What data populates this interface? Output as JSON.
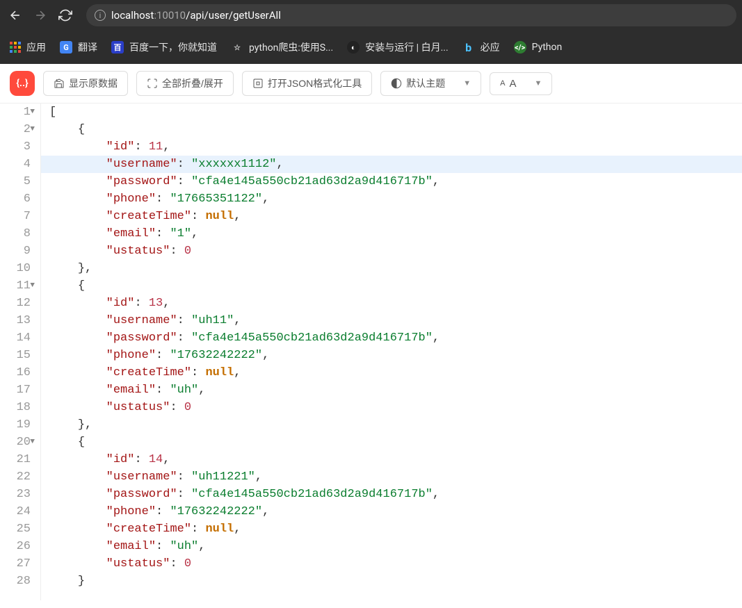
{
  "nav": {
    "url_host": "localhost",
    "url_port": ":10010",
    "url_path": "/api/user/getUserAll"
  },
  "bookmarks": [
    {
      "label": "应用",
      "icon": "apps"
    },
    {
      "label": "翻译",
      "icon": "translate",
      "color": "#4285f4"
    },
    {
      "label": "百度一下，你就知道",
      "icon": "baidu",
      "color": "#2a3ec8"
    },
    {
      "label": "python爬虫:使用S...",
      "icon": "star",
      "color": "transparent"
    },
    {
      "label": "安装与运行 | 白月...",
      "icon": "moon",
      "color": "#333"
    },
    {
      "label": "必应",
      "icon": "bing",
      "color": "transparent"
    },
    {
      "label": "Python",
      "icon": "py",
      "color": "#2e7d32"
    }
  ],
  "toolbar": {
    "show_raw": "显示原数据",
    "collapse_expand": "全部折叠/展开",
    "open_formatter": "打开JSON格式化工具",
    "theme": "默认主题",
    "font_size": "A"
  },
  "json": {
    "lines": [
      {
        "num": 1,
        "fold": true,
        "indent": 0,
        "tokens": [
          {
            "t": "p",
            "v": "["
          }
        ]
      },
      {
        "num": 2,
        "fold": true,
        "indent": 1,
        "tokens": [
          {
            "t": "p",
            "v": "{"
          }
        ]
      },
      {
        "num": 3,
        "indent": 2,
        "tokens": [
          {
            "t": "k",
            "v": "\"id\""
          },
          {
            "t": "p",
            "v": ": "
          },
          {
            "t": "n",
            "v": "11"
          },
          {
            "t": "p",
            "v": ","
          }
        ]
      },
      {
        "num": 4,
        "indent": 2,
        "hl": true,
        "tokens": [
          {
            "t": "k",
            "v": "\"username\""
          },
          {
            "t": "p",
            "v": ": "
          },
          {
            "t": "s",
            "v": "\"xxxxxx1112\""
          },
          {
            "t": "p",
            "v": ","
          }
        ]
      },
      {
        "num": 5,
        "indent": 2,
        "tokens": [
          {
            "t": "k",
            "v": "\"password\""
          },
          {
            "t": "p",
            "v": ": "
          },
          {
            "t": "s",
            "v": "\"cfa4e145a550cb21ad63d2a9d416717b\""
          },
          {
            "t": "p",
            "v": ","
          }
        ]
      },
      {
        "num": 6,
        "indent": 2,
        "tokens": [
          {
            "t": "k",
            "v": "\"phone\""
          },
          {
            "t": "p",
            "v": ": "
          },
          {
            "t": "s",
            "v": "\"17665351122\""
          },
          {
            "t": "p",
            "v": ","
          }
        ]
      },
      {
        "num": 7,
        "indent": 2,
        "tokens": [
          {
            "t": "k",
            "v": "\"createTime\""
          },
          {
            "t": "p",
            "v": ": "
          },
          {
            "t": "nl",
            "v": "null"
          },
          {
            "t": "p",
            "v": ","
          }
        ]
      },
      {
        "num": 8,
        "indent": 2,
        "tokens": [
          {
            "t": "k",
            "v": "\"email\""
          },
          {
            "t": "p",
            "v": ": "
          },
          {
            "t": "s",
            "v": "\"1\""
          },
          {
            "t": "p",
            "v": ","
          }
        ]
      },
      {
        "num": 9,
        "indent": 2,
        "tokens": [
          {
            "t": "k",
            "v": "\"ustatus\""
          },
          {
            "t": "p",
            "v": ": "
          },
          {
            "t": "n",
            "v": "0"
          }
        ]
      },
      {
        "num": 10,
        "indent": 1,
        "tokens": [
          {
            "t": "p",
            "v": "},"
          }
        ]
      },
      {
        "num": 11,
        "fold": true,
        "indent": 1,
        "tokens": [
          {
            "t": "p",
            "v": "{"
          }
        ]
      },
      {
        "num": 12,
        "indent": 2,
        "tokens": [
          {
            "t": "k",
            "v": "\"id\""
          },
          {
            "t": "p",
            "v": ": "
          },
          {
            "t": "n",
            "v": "13"
          },
          {
            "t": "p",
            "v": ","
          }
        ]
      },
      {
        "num": 13,
        "indent": 2,
        "tokens": [
          {
            "t": "k",
            "v": "\"username\""
          },
          {
            "t": "p",
            "v": ": "
          },
          {
            "t": "s",
            "v": "\"uh11\""
          },
          {
            "t": "p",
            "v": ","
          }
        ]
      },
      {
        "num": 14,
        "indent": 2,
        "tokens": [
          {
            "t": "k",
            "v": "\"password\""
          },
          {
            "t": "p",
            "v": ": "
          },
          {
            "t": "s",
            "v": "\"cfa4e145a550cb21ad63d2a9d416717b\""
          },
          {
            "t": "p",
            "v": ","
          }
        ]
      },
      {
        "num": 15,
        "indent": 2,
        "tokens": [
          {
            "t": "k",
            "v": "\"phone\""
          },
          {
            "t": "p",
            "v": ": "
          },
          {
            "t": "s",
            "v": "\"17632242222\""
          },
          {
            "t": "p",
            "v": ","
          }
        ]
      },
      {
        "num": 16,
        "indent": 2,
        "tokens": [
          {
            "t": "k",
            "v": "\"createTime\""
          },
          {
            "t": "p",
            "v": ": "
          },
          {
            "t": "nl",
            "v": "null"
          },
          {
            "t": "p",
            "v": ","
          }
        ]
      },
      {
        "num": 17,
        "indent": 2,
        "tokens": [
          {
            "t": "k",
            "v": "\"email\""
          },
          {
            "t": "p",
            "v": ": "
          },
          {
            "t": "s",
            "v": "\"uh\""
          },
          {
            "t": "p",
            "v": ","
          }
        ]
      },
      {
        "num": 18,
        "indent": 2,
        "tokens": [
          {
            "t": "k",
            "v": "\"ustatus\""
          },
          {
            "t": "p",
            "v": ": "
          },
          {
            "t": "n",
            "v": "0"
          }
        ]
      },
      {
        "num": 19,
        "indent": 1,
        "tokens": [
          {
            "t": "p",
            "v": "},"
          }
        ]
      },
      {
        "num": 20,
        "fold": true,
        "indent": 1,
        "tokens": [
          {
            "t": "p",
            "v": "{"
          }
        ]
      },
      {
        "num": 21,
        "indent": 2,
        "tokens": [
          {
            "t": "k",
            "v": "\"id\""
          },
          {
            "t": "p",
            "v": ": "
          },
          {
            "t": "n",
            "v": "14"
          },
          {
            "t": "p",
            "v": ","
          }
        ]
      },
      {
        "num": 22,
        "indent": 2,
        "tokens": [
          {
            "t": "k",
            "v": "\"username\""
          },
          {
            "t": "p",
            "v": ": "
          },
          {
            "t": "s",
            "v": "\"uh11221\""
          },
          {
            "t": "p",
            "v": ","
          }
        ]
      },
      {
        "num": 23,
        "indent": 2,
        "tokens": [
          {
            "t": "k",
            "v": "\"password\""
          },
          {
            "t": "p",
            "v": ": "
          },
          {
            "t": "s",
            "v": "\"cfa4e145a550cb21ad63d2a9d416717b\""
          },
          {
            "t": "p",
            "v": ","
          }
        ]
      },
      {
        "num": 24,
        "indent": 2,
        "tokens": [
          {
            "t": "k",
            "v": "\"phone\""
          },
          {
            "t": "p",
            "v": ": "
          },
          {
            "t": "s",
            "v": "\"17632242222\""
          },
          {
            "t": "p",
            "v": ","
          }
        ]
      },
      {
        "num": 25,
        "indent": 2,
        "tokens": [
          {
            "t": "k",
            "v": "\"createTime\""
          },
          {
            "t": "p",
            "v": ": "
          },
          {
            "t": "nl",
            "v": "null"
          },
          {
            "t": "p",
            "v": ","
          }
        ]
      },
      {
        "num": 26,
        "indent": 2,
        "tokens": [
          {
            "t": "k",
            "v": "\"email\""
          },
          {
            "t": "p",
            "v": ": "
          },
          {
            "t": "s",
            "v": "\"uh\""
          },
          {
            "t": "p",
            "v": ","
          }
        ]
      },
      {
        "num": 27,
        "indent": 2,
        "tokens": [
          {
            "t": "k",
            "v": "\"ustatus\""
          },
          {
            "t": "p",
            "v": ": "
          },
          {
            "t": "n",
            "v": "0"
          }
        ]
      },
      {
        "num": 28,
        "indent": 1,
        "tokens": [
          {
            "t": "p",
            "v": "}"
          }
        ]
      }
    ]
  }
}
